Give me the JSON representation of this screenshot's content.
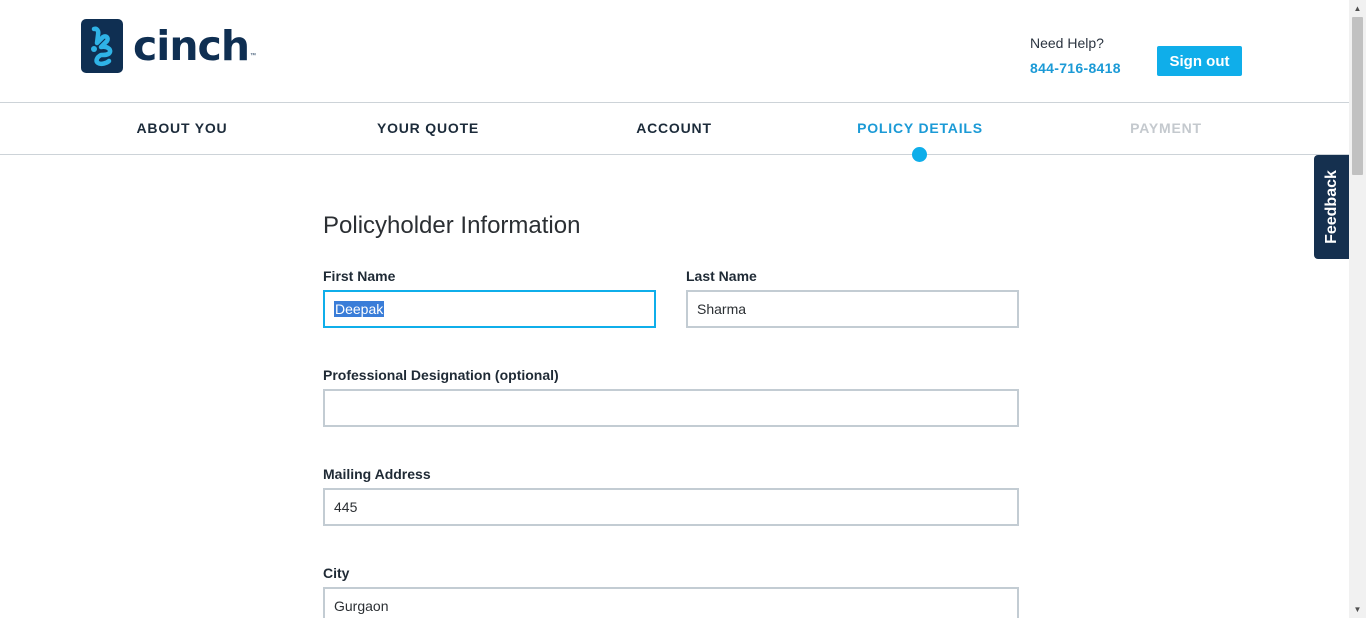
{
  "header": {
    "logo_text": "cinch",
    "logo_tm": "™",
    "help_label": "Need Help?",
    "help_phone": "844-716-8418",
    "signout_label": "Sign out"
  },
  "steps": [
    {
      "label": "ABOUT YOU",
      "state": "done"
    },
    {
      "label": "YOUR QUOTE",
      "state": "done"
    },
    {
      "label": "ACCOUNT",
      "state": "done"
    },
    {
      "label": "POLICY DETAILS",
      "state": "active"
    },
    {
      "label": "PAYMENT",
      "state": "disabled"
    }
  ],
  "form": {
    "title": "Policyholder Information",
    "first_name": {
      "label": "First Name",
      "value": "Deepak"
    },
    "last_name": {
      "label": "Last Name",
      "value": "Sharma"
    },
    "designation": {
      "label": "Professional Designation (optional)",
      "value": ""
    },
    "mailing_address": {
      "label": "Mailing Address",
      "value": "445"
    },
    "city": {
      "label": "City",
      "value": "Gurgaon"
    }
  },
  "feedback_label": "Feedback",
  "colors": {
    "brand_navy": "#0f2f52",
    "accent_blue": "#0faeea",
    "active_step": "#1b9ad6",
    "disabled_step": "#c4c9ce"
  },
  "icons": {
    "logo": "cinch-hand-logo-icon",
    "scroll_up": "scroll-up-arrow-icon",
    "scroll_down": "scroll-down-arrow-icon"
  }
}
